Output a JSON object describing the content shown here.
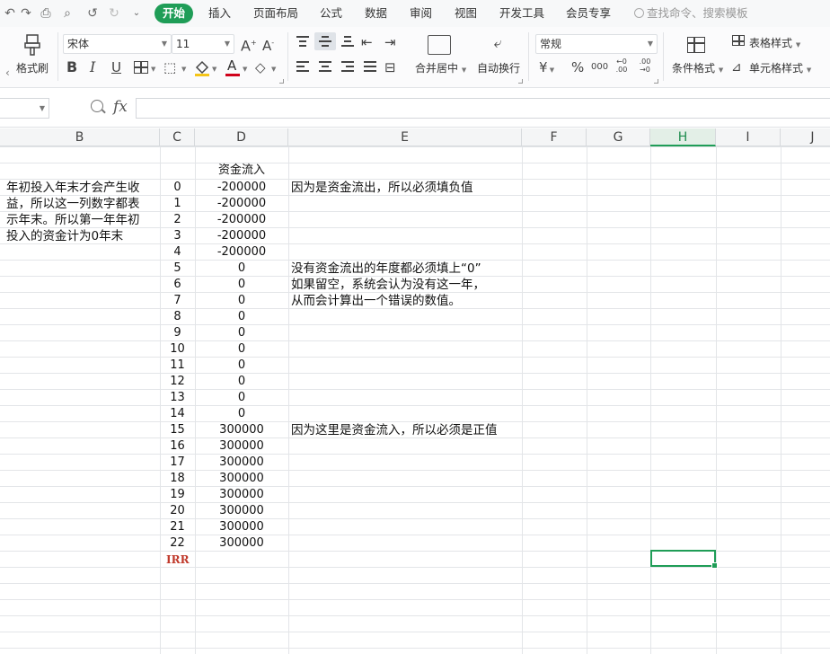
{
  "menubar": {
    "quick_icons": [
      "undo-history-icon",
      "redo-history-icon",
      "print-icon",
      "print-preview-icon",
      "undo-icon",
      "redo-icon",
      "more-icon"
    ],
    "tabs": [
      "开始",
      "插入",
      "页面布局",
      "公式",
      "数据",
      "审阅",
      "视图",
      "开发工具",
      "会员专享"
    ],
    "active_tab": "开始",
    "search_placeholder": "查找命令、搜索模板"
  },
  "ribbon": {
    "format_painter": "格式刷",
    "font_name": "宋体",
    "font_size": "11",
    "bold": "B",
    "italic": "I",
    "underline": "U",
    "merge_center": "合并居中",
    "wrap_text": "自动换行",
    "number_format": "常规",
    "currency": "¥",
    "percent": "%",
    "thousands": "000",
    "dec_increase": "←0 .00",
    "dec_decrease": ".00 →0",
    "conditional_format": "条件格式",
    "table_style": "表格样式",
    "cell_style": "单元格样式",
    "font_color": "#d0021b",
    "fill_color": "#f5c518"
  },
  "formulabar": {
    "fx": "fx",
    "cell_ref": "",
    "content": ""
  },
  "sheet": {
    "columns": [
      "B",
      "C",
      "D",
      "E",
      "F",
      "G",
      "H",
      "I",
      "J"
    ],
    "selected_column": "H",
    "header_label": "资金流入",
    "b_note": [
      "年初投入年末才会产生收",
      "益，所以这一列数字都表",
      "示年末。所以第一年年初",
      "投入的资金计为0年末"
    ],
    "years": [
      "0",
      "1",
      "2",
      "3",
      "4",
      "5",
      "6",
      "7",
      "8",
      "9",
      "10",
      "11",
      "12",
      "13",
      "14",
      "15",
      "16",
      "17",
      "18",
      "19",
      "20",
      "21",
      "22"
    ],
    "flows": [
      "-200000",
      "-200000",
      "-200000",
      "-200000",
      "-200000",
      "0",
      "0",
      "0",
      "0",
      "0",
      "0",
      "0",
      "0",
      "0",
      "0",
      "300000",
      "300000",
      "300000",
      "300000",
      "300000",
      "300000",
      "300000",
      "300000"
    ],
    "e_note_1": "因为是资金流出，所以必须填负值",
    "e_note_2": [
      "没有资金流出的年度都必须填上“0”",
      "如果留空，系统会认为没有这一年，",
      "从而会计算出一个错误的数值。"
    ],
    "e_note_3": "因为这里是资金流入，所以必须是正值",
    "irr_label": "IRR",
    "accent": "#1f9d57",
    "irr_color": "#c0392b"
  }
}
